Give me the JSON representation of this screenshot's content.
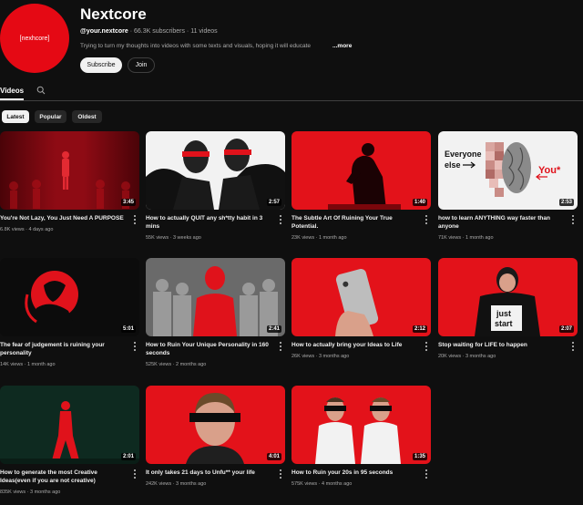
{
  "channel": {
    "avatar_text": "[nexhcore]",
    "name": "Nextcore",
    "handle": "@your.nextcore",
    "stats": "· 66.3K subscribers · 11 videos",
    "description": "Trying to turn my thoughts into videos with some texts and visuals, hoping it will educate",
    "more_label": "...more",
    "subscribe_label": "Subscribe",
    "join_label": "Join"
  },
  "tabs": {
    "videos_label": "Videos"
  },
  "chips": [
    "Latest",
    "Popular",
    "Oldest"
  ],
  "videos": [
    {
      "title": "You're Not Lazy, You Just Need A PURPOSE",
      "meta": "6.8K views · 4 days ago",
      "duration": "3:45"
    },
    {
      "title": "How to actually QUIT any sh*tty habit in 3 mins",
      "meta": "55K views · 3 weeks ago",
      "duration": "2:57"
    },
    {
      "title": "The Subtle Art Of Ruining Your True Potential.",
      "meta": "23K views · 1 month ago",
      "duration": "1:40"
    },
    {
      "title": "how to learn ANYTHING way faster than anyone",
      "meta": "71K views · 1 month ago",
      "duration": "2:53"
    },
    {
      "title": "The fear of judgement is ruining your personality",
      "meta": "14K views · 1 month ago",
      "duration": "5:01"
    },
    {
      "title": "How to Ruin Your Unique Personality in 160 seconds",
      "meta": "525K views · 2 months ago",
      "duration": "2:41"
    },
    {
      "title": "How to actually bring your Ideas to Life",
      "meta": "26K views · 3 months ago",
      "duration": "2:12"
    },
    {
      "title": "Stop waiting for LIFE to happen",
      "meta": "20K views · 3 months ago",
      "duration": "2:07"
    },
    {
      "title": "How to generate the most Creative Ideas(even if you are not creative)",
      "meta": "835K views · 3 months ago",
      "duration": "2:01"
    },
    {
      "title": "It only takes 21 days to Unfu** your life",
      "meta": "242K views · 3 months ago",
      "duration": "4:01"
    },
    {
      "title": "How to Ruin your 20s in 95 seconds",
      "meta": "575K views · 4 months ago",
      "duration": "1:35"
    }
  ],
  "thumb_texts": {
    "v4_everyone": "Everyone",
    "v4_else": "else",
    "v4_you": "You*",
    "v8_sign_1": "just",
    "v8_sign_2": "start"
  }
}
